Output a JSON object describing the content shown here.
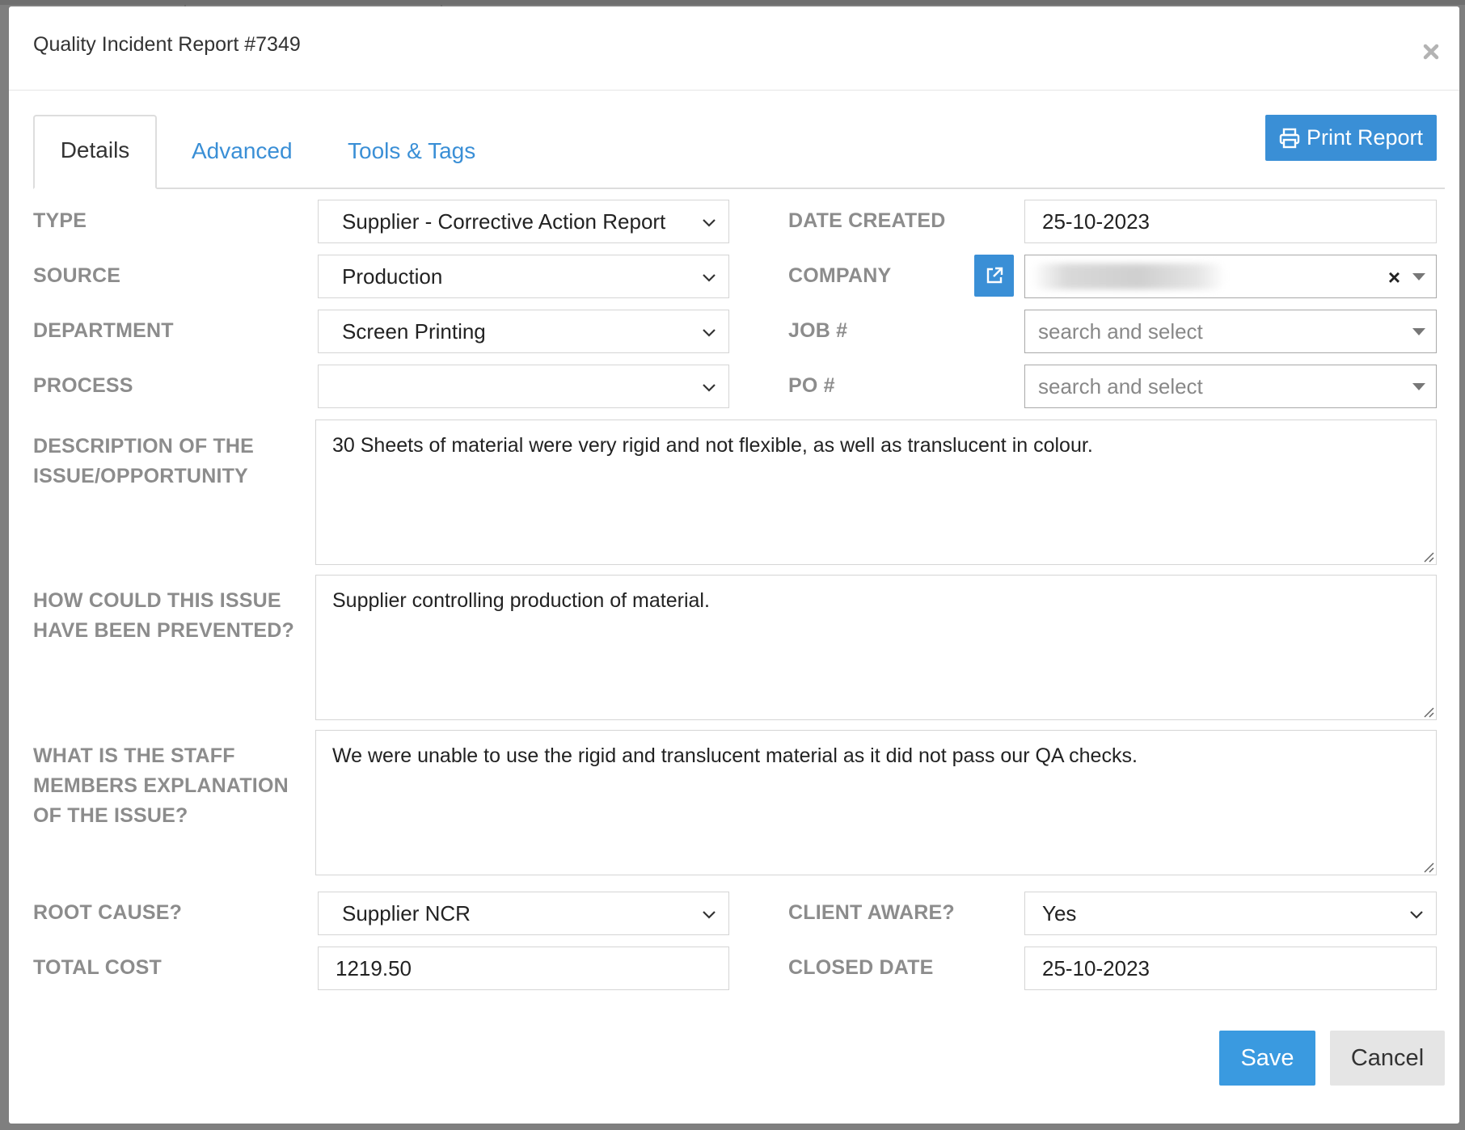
{
  "modal": {
    "title": "Quality Incident Report #7349"
  },
  "tabs": [
    {
      "label": "Details",
      "active": true
    },
    {
      "label": "Advanced",
      "active": false
    },
    {
      "label": "Tools & Tags",
      "active": false
    }
  ],
  "toolbar": {
    "print_label": "Print Report"
  },
  "form": {
    "type": {
      "label": "TYPE",
      "value": "Supplier - Corrective Action Report"
    },
    "source": {
      "label": "SOURCE",
      "value": "Production"
    },
    "department": {
      "label": "DEPARTMENT",
      "value": "Screen Printing"
    },
    "process": {
      "label": "PROCESS",
      "value": ""
    },
    "date_created": {
      "label": "DATE CREATED",
      "value": "25-10-2023"
    },
    "company": {
      "label": "COMPANY",
      "value": ""
    },
    "job": {
      "label": "JOB #",
      "placeholder": "search and select"
    },
    "po": {
      "label": "PO #",
      "placeholder": "search and select"
    },
    "description": {
      "label_line1": "DESCRIPTION OF THE",
      "label_line2": "ISSUE/OPPORTUNITY",
      "value": "30 Sheets of material were very rigid and not flexible, as well as translucent in colour."
    },
    "prevention": {
      "label_line1": "HOW COULD THIS ISSUE",
      "label_line2": "HAVE BEEN PREVENTED?",
      "value": "Supplier controlling production of material."
    },
    "staff_explanation": {
      "label_line1": "WHAT IS THE STAFF",
      "label_line2": "MEMBERS EXPLANATION",
      "label_line3": "OF THE ISSUE?",
      "value": "We were unable to use the rigid and translucent material as it did not pass our QA checks."
    },
    "root_cause": {
      "label": "ROOT CAUSE?",
      "value": "Supplier NCR"
    },
    "client_aware": {
      "label": "CLIENT AWARE?",
      "value": "Yes"
    },
    "total_cost": {
      "label": "TOTAL COST",
      "value": "1219.50"
    },
    "closed_date": {
      "label": "CLOSED DATE",
      "value": "25-10-2023"
    }
  },
  "footer": {
    "save_label": "Save",
    "cancel_label": "Cancel"
  },
  "colors": {
    "accent": "#3a8fd6",
    "label_gray": "#8c8c8c"
  },
  "icons": [
    "close-icon",
    "printer-icon",
    "external-link-icon",
    "chevron-down-icon",
    "dropdown-caret-icon",
    "clear-icon",
    "resize-grip-icon"
  ]
}
